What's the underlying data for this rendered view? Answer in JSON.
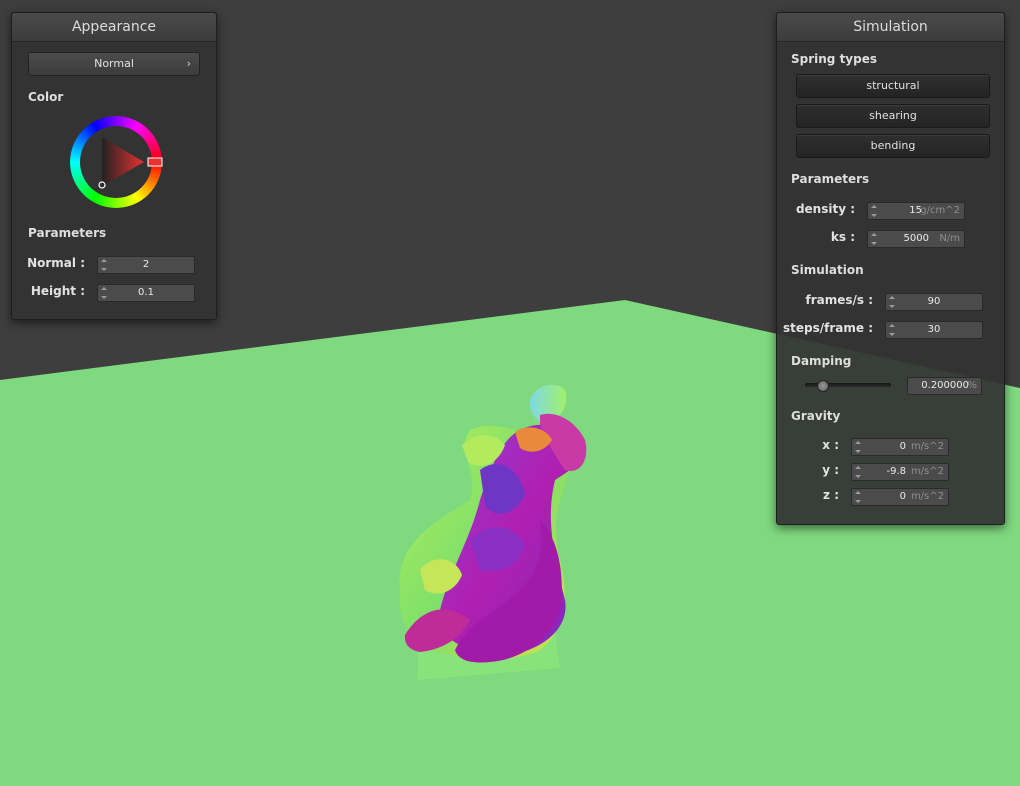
{
  "appearance": {
    "title": "Appearance",
    "shader_select": "Normal",
    "color_label": "Color",
    "params_label": "Parameters",
    "normal": {
      "label": "Normal :",
      "value": "2"
    },
    "height": {
      "label": "Height :",
      "value": "0.1"
    },
    "selected_color": "#e83232"
  },
  "simulation": {
    "title": "Simulation",
    "spring_types_label": "Spring types",
    "spring_buttons": [
      "structural",
      "shearing",
      "bending"
    ],
    "params_label": "Parameters",
    "density": {
      "label": "density :",
      "value": "15",
      "unit": "g/cm^2"
    },
    "ks": {
      "label": "ks :",
      "value": "5000",
      "unit": "N/m"
    },
    "sim_label": "Simulation",
    "frames": {
      "label": "frames/s :",
      "value": "90"
    },
    "steps": {
      "label": "steps/frame :",
      "value": "30"
    },
    "damping_label": "Damping",
    "damping": {
      "value": "0.200000",
      "unit": "%",
      "level": 0.2
    },
    "gravity_label": "Gravity",
    "gx": {
      "label": "x :",
      "value": "0",
      "unit": "m/s^2"
    },
    "gy": {
      "label": "y :",
      "value": "-9.8",
      "unit": "m/s^2"
    },
    "gz": {
      "label": "z :",
      "value": "0",
      "unit": "m/s^2"
    }
  },
  "colors": {
    "floor": "#7fd97f",
    "background": "#3e3e3e",
    "cloth_primary": "#8a2ab0",
    "cloth_secondary": "#9ae060"
  }
}
